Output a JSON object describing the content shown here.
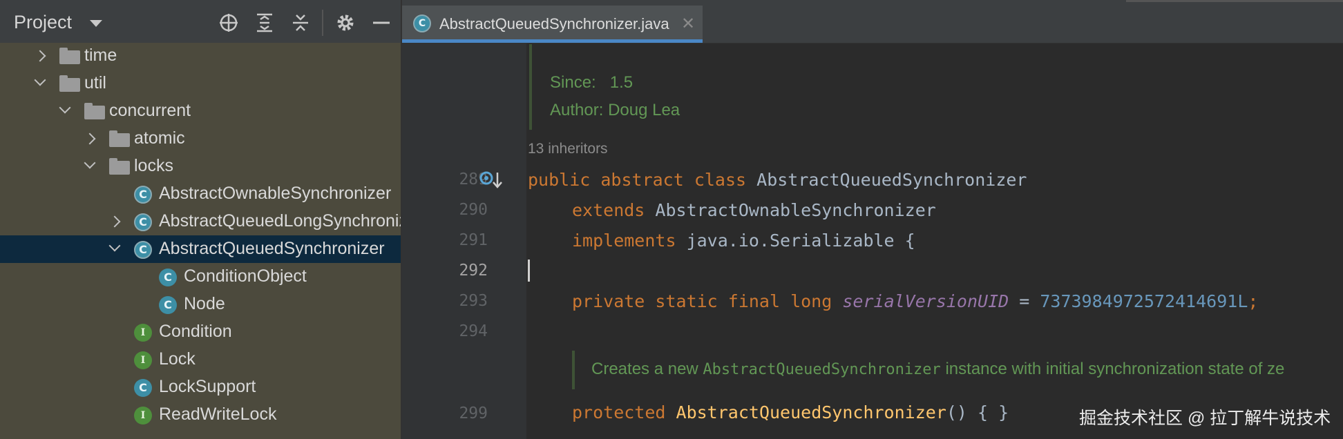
{
  "project_panel": {
    "title": "Project",
    "tree": [
      {
        "label": "time",
        "icon": "folder-icon",
        "chevron": "right"
      },
      {
        "label": "util",
        "icon": "folder-icon",
        "chevron": "down"
      },
      {
        "label": "concurrent",
        "icon": "folder-icon",
        "chevron": "down"
      },
      {
        "label": "atomic",
        "icon": "folder-icon",
        "chevron": "right"
      },
      {
        "label": "locks",
        "icon": "folder-icon",
        "chevron": "down"
      },
      {
        "label": "AbstractOwnableSynchronizer",
        "icon": "abstract-class-icon",
        "chevron": "none"
      },
      {
        "label": "AbstractQueuedLongSynchronizer",
        "icon": "abstract-class-icon",
        "chevron": "right"
      },
      {
        "label": "AbstractQueuedSynchronizer",
        "icon": "abstract-class-icon",
        "chevron": "down",
        "selected": true
      },
      {
        "label": "ConditionObject",
        "icon": "class-icon",
        "chevron": "none"
      },
      {
        "label": "Node",
        "icon": "class-icon",
        "chevron": "none"
      },
      {
        "label": "Condition",
        "icon": "interface-icon",
        "chevron": "none"
      },
      {
        "label": "Lock",
        "icon": "interface-icon",
        "chevron": "none"
      },
      {
        "label": "LockSupport",
        "icon": "class-icon",
        "chevron": "none"
      },
      {
        "label": "ReadWriteLock",
        "icon": "interface-icon",
        "chevron": "none"
      }
    ]
  },
  "editor": {
    "tab": {
      "label": "AbstractQueuedSynchronizer.java"
    },
    "doc_since_label": "Since:",
    "doc_since_value": "1.5",
    "doc_author_label": "Author:",
    "doc_author_value": "Doug Lea",
    "inheritors": "13 inheritors",
    "line_numbers": [
      "289",
      "290",
      "291",
      "292",
      "293",
      "294",
      "299"
    ],
    "current_line": "292",
    "code": {
      "l289_kw": "public abstract class",
      "l289_name": "AbstractQueuedSynchronizer",
      "l290_kw": "extends",
      "l290_name": "AbstractOwnableSynchronizer",
      "l291_kw": "implements",
      "l291_name": "java.io.Serializable {",
      "l293_kw": "private static final long",
      "l293_field": "serialVersionUID",
      "l293_eq": " = ",
      "l293_num": "7373984972572414691L",
      "l293_semi": ";",
      "doc_pre": "Creates a new ",
      "doc_code": "AbstractQueuedSynchronizer",
      "doc_post": " instance with initial synchronization state of ze",
      "l299_kw": "protected",
      "l299_name": "AbstractQueuedSynchronizer",
      "l299_rest": "() { }"
    }
  },
  "watermark": "掘金技术社区 @ 拉丁解牛说技术",
  "colors": {
    "keyword": "#cc7832",
    "method": "#ffc66d",
    "number": "#6897bb",
    "field": "#9876aa",
    "doc": "#629755",
    "selection": "#0d293e",
    "tab_accent": "#4a88c7"
  }
}
